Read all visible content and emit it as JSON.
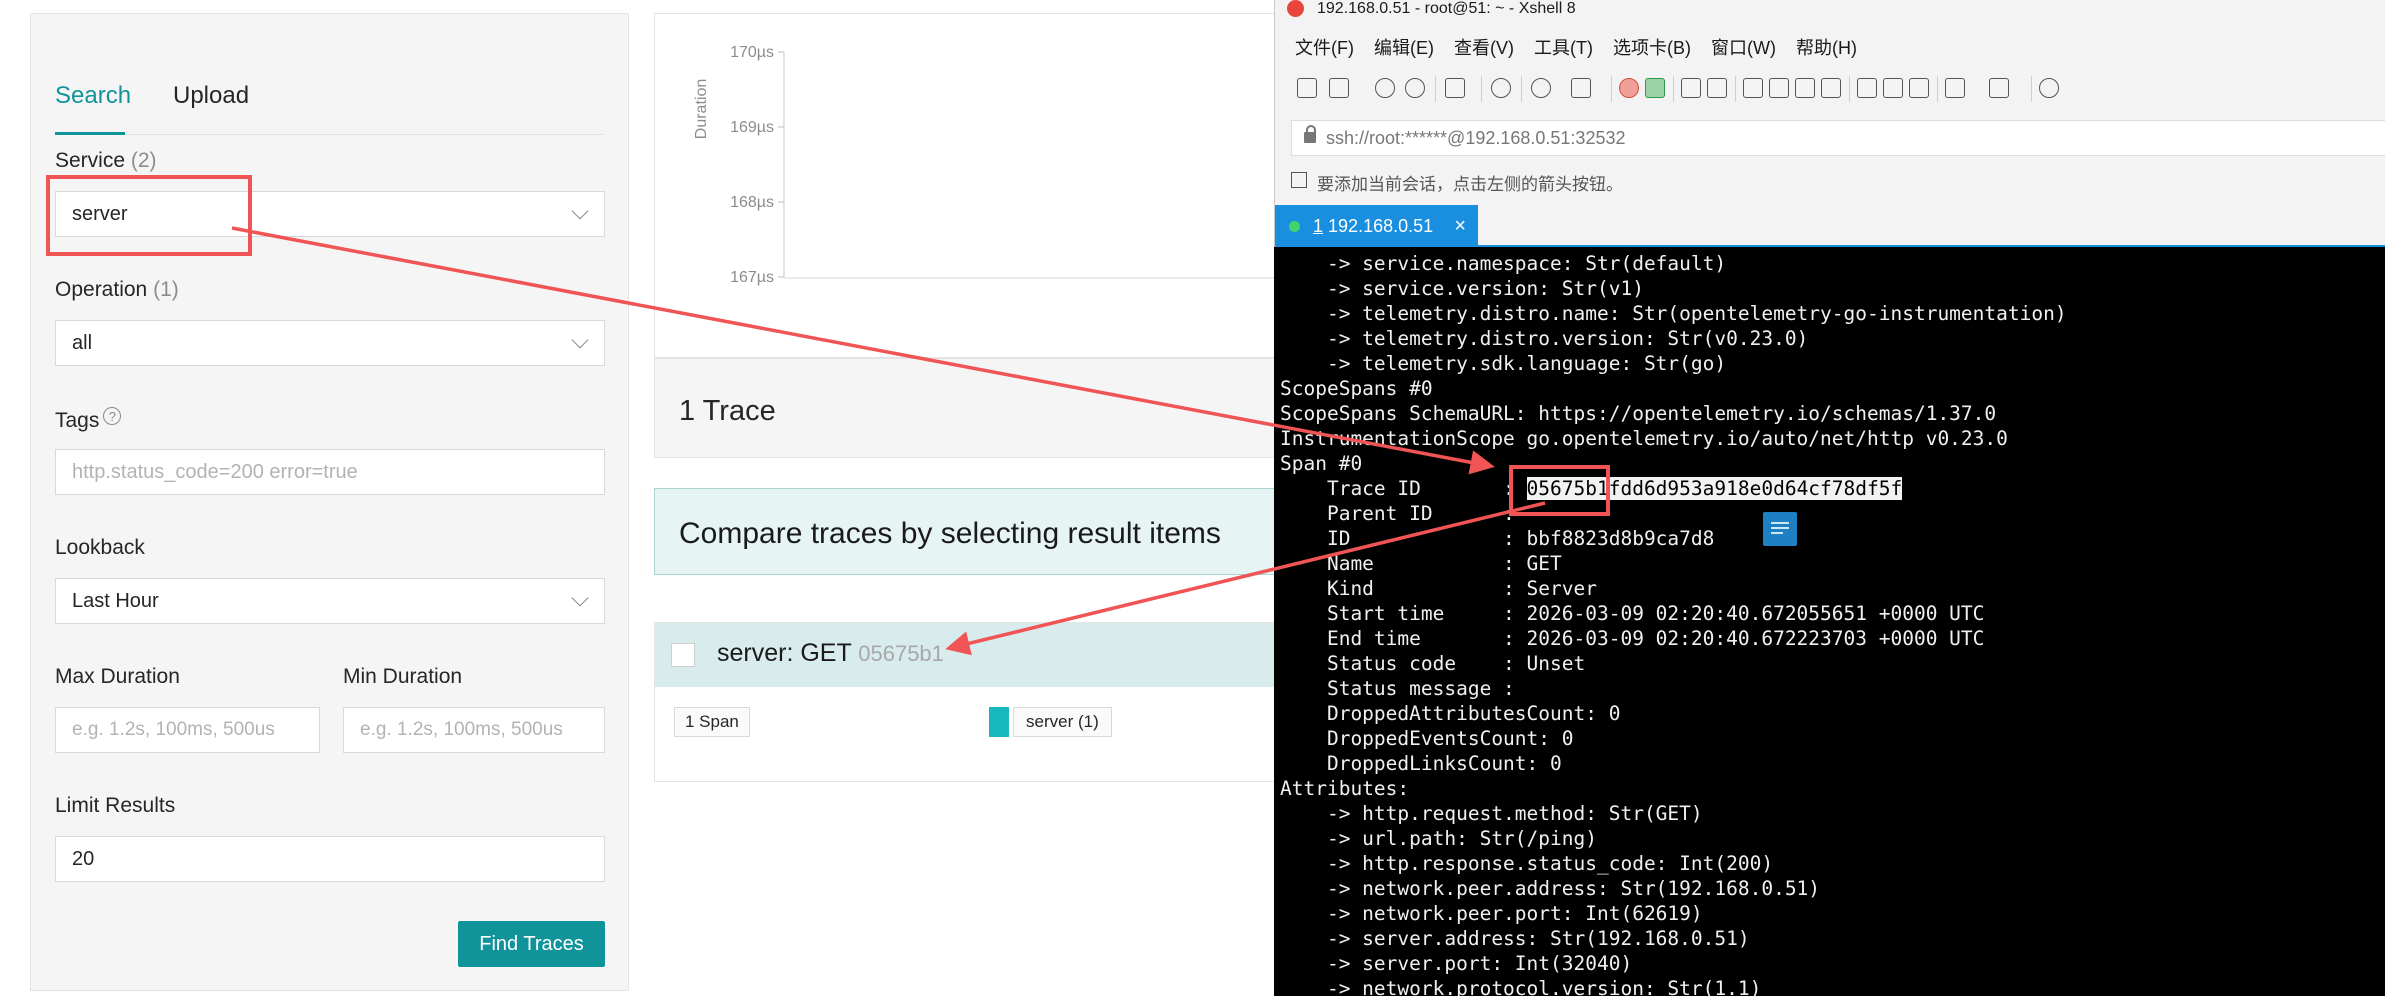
{
  "search": {
    "tabs": [
      "Search",
      "Upload"
    ],
    "service_label": "Service",
    "service_count": "(2)",
    "service_value": "server",
    "operation_label": "Operation",
    "operation_count": "(1)",
    "operation_value": "all",
    "tags_label": "Tags",
    "tags_placeholder": "http.status_code=200 error=true",
    "lookback_label": "Lookback",
    "lookback_value": "Last Hour",
    "max_duration_label": "Max Duration",
    "max_duration_placeholder": "e.g. 1.2s, 100ms, 500us",
    "min_duration_label": "Min Duration",
    "min_duration_placeholder": "e.g. 1.2s, 100ms, 500us",
    "limit_label": "Limit Results",
    "limit_value": "20",
    "find_button": "Find Traces"
  },
  "chart": {
    "ylabel": "Duration",
    "y_ticks": [
      "170µs",
      "169µs",
      "168µs",
      "167µs"
    ]
  },
  "results": {
    "trace_count": "1 Trace",
    "compare_text": "Compare traces by selecting result items",
    "trace_title": "server: GET",
    "trace_id": "05675b1",
    "span_count": "1 Span",
    "service_tag": "server (1)"
  },
  "xshell": {
    "title": "192.168.0.51 - root@51: ~ - Xshell 8",
    "menu": [
      "文件(F)",
      "编辑(E)",
      "查看(V)",
      "工具(T)",
      "选项卡(B)",
      "窗口(W)",
      "帮助(H)"
    ],
    "address": "ssh://root:******@192.168.0.51:32532",
    "hint": "要添加当前会话，点击左侧的箭头按钮。",
    "tab_num": "1",
    "tab_host": "192.168.0.51",
    "tab_close": "×",
    "terminal_lines": [
      "    -> service.namespace: Str(default)",
      "    -> service.version: Str(v1)",
      "    -> telemetry.distro.name: Str(opentelemetry-go-instrumentation)",
      "    -> telemetry.distro.version: Str(v0.23.0)",
      "    -> telemetry.sdk.language: Str(go)",
      "ScopeSpans #0",
      "ScopeSpans SchemaURL: https://opentelemetry.io/schemas/1.37.0",
      "InstrumentationScope go.opentelemetry.io/auto/net/http v0.23.0",
      "Span #0",
      "TRACE_LINE",
      "    Parent ID      :",
      "    ID             : bbf8823d8b9ca7d8",
      "    Name           : GET",
      "    Kind           : Server",
      "    Start time     : 2026-03-09 02:20:40.672055651 +0000 UTC",
      "    End time       : 2026-03-09 02:20:40.672223703 +0000 UTC",
      "    Status code    : Unset",
      "    Status message :",
      "    DroppedAttributesCount: 0",
      "    DroppedEventsCount: 0",
      "    DroppedLinksCount: 0",
      "Attributes:",
      "    -> http.request.method: Str(GET)",
      "    -> url.path: Str(/ping)",
      "    -> http.response.status_code: Int(200)",
      "    -> network.peer.address: Str(192.168.0.51)",
      "    -> network.peer.port: Int(62619)",
      "    -> server.address: Str(192.168.0.51)",
      "    -> server.port: Int(32040)",
      "    -> network.protocol.version: Str(1.1)"
    ],
    "trace_prefix": "    Trace ID       : ",
    "trace_id_full": "05675b1fdd6d953a918e0d64cf78df5f"
  },
  "colors": {
    "accent": "#11939a",
    "annotation_red": "#f05454",
    "xshell_tab": "#1a8fe0"
  }
}
